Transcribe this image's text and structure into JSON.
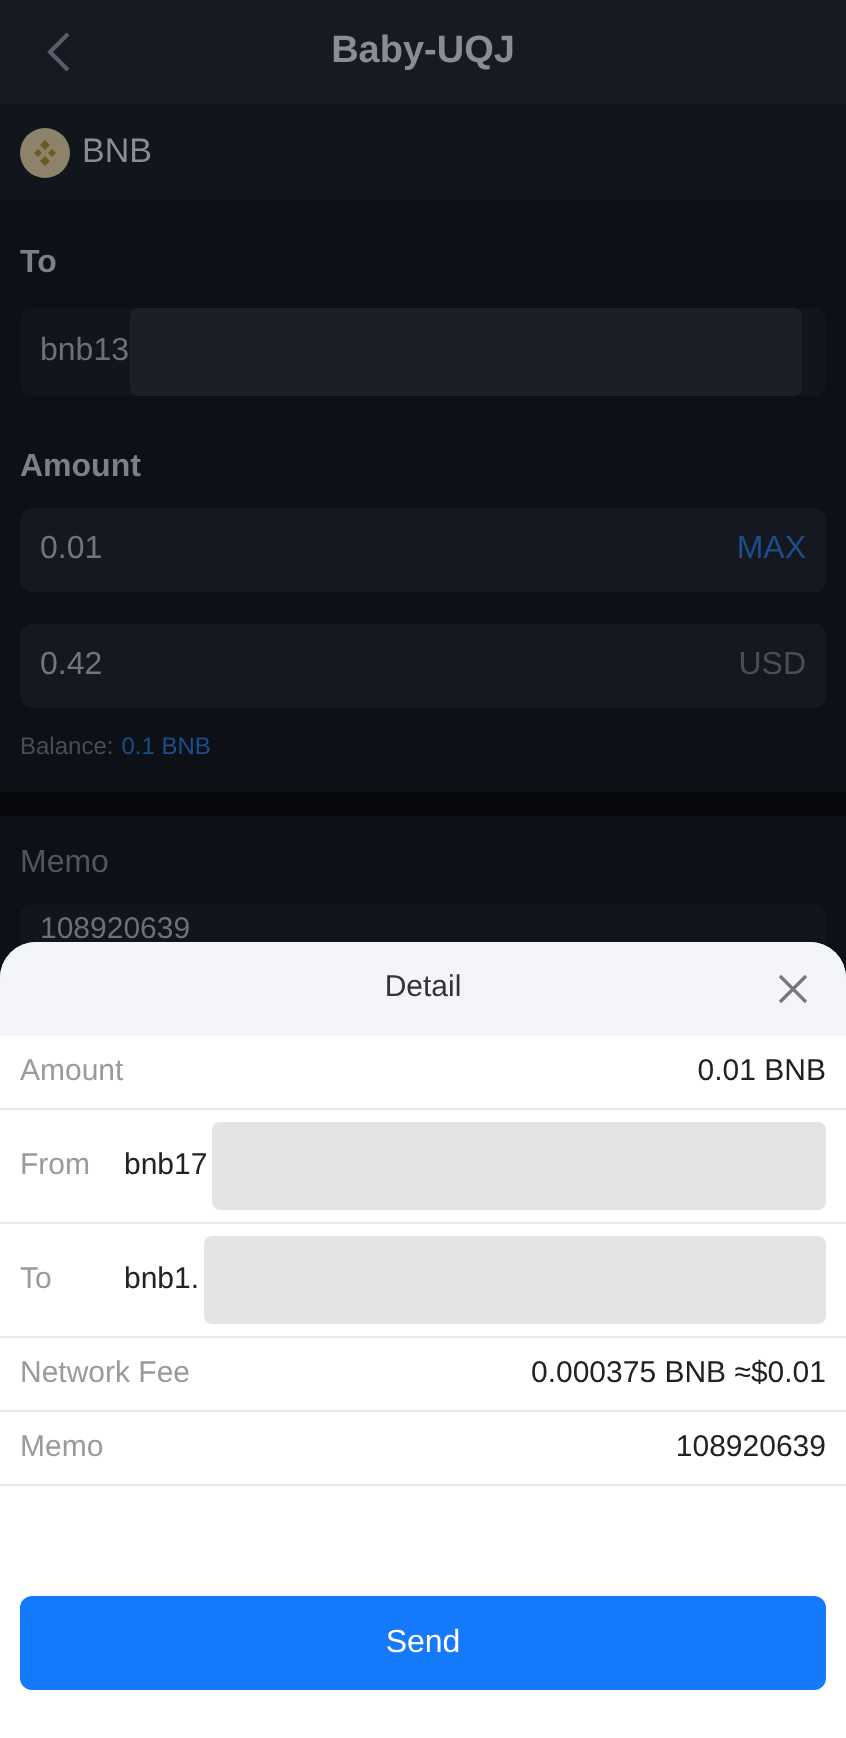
{
  "header": {
    "title": "Baby-UQJ"
  },
  "coin": {
    "symbol": "BNB"
  },
  "to": {
    "label": "To",
    "value": "bnb13"
  },
  "amount": {
    "label": "Amount",
    "value": "0.01",
    "max": "MAX",
    "fiat_value": "0.42",
    "fiat_unit": "USD",
    "balance_label": "Balance:",
    "balance_value": "0.1 BNB"
  },
  "memo": {
    "label": "Memo",
    "value": "108920639"
  },
  "detail": {
    "title": "Detail",
    "rows": [
      {
        "kind": "plain",
        "label": "Amount",
        "value": "0.01 BNB"
      },
      {
        "kind": "address",
        "label": "From",
        "value": "bnb17"
      },
      {
        "kind": "address",
        "label": "To",
        "value": "bnb1."
      },
      {
        "kind": "plain",
        "label": "Network Fee",
        "value": "0.000375 BNB ≈$0.01"
      },
      {
        "kind": "plain",
        "label": "Memo",
        "value": "108920639"
      }
    ],
    "send": "Send"
  }
}
